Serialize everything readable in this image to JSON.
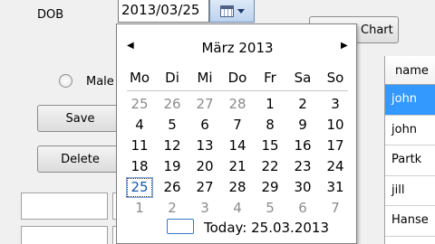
{
  "form": {
    "dob_label": "DOB",
    "dob_value": "2013/03/25",
    "chart_label": "Chart",
    "male_label": "Male",
    "save_label": "Save",
    "delete_label": "Delete"
  },
  "grid": {
    "header": "name",
    "rows": [
      "john",
      "john",
      "Partk",
      "jill",
      "Hanse"
    ],
    "selected_index": 0
  },
  "calendar": {
    "month_title": "März 2013",
    "prev_glyph": "◀",
    "next_glyph": "▶",
    "weekdays": [
      "Mo",
      "Di",
      "Mi",
      "Do",
      "Fr",
      "Sa",
      "So"
    ],
    "days": [
      {
        "d": "25",
        "other": true
      },
      {
        "d": "26",
        "other": true
      },
      {
        "d": "27",
        "other": true
      },
      {
        "d": "28",
        "other": true
      },
      {
        "d": "1"
      },
      {
        "d": "2"
      },
      {
        "d": "3"
      },
      {
        "d": "4"
      },
      {
        "d": "5"
      },
      {
        "d": "6"
      },
      {
        "d": "7"
      },
      {
        "d": "8"
      },
      {
        "d": "9"
      },
      {
        "d": "10"
      },
      {
        "d": "11"
      },
      {
        "d": "12"
      },
      {
        "d": "13"
      },
      {
        "d": "14"
      },
      {
        "d": "15"
      },
      {
        "d": "16"
      },
      {
        "d": "17"
      },
      {
        "d": "18"
      },
      {
        "d": "19"
      },
      {
        "d": "20"
      },
      {
        "d": "21"
      },
      {
        "d": "22"
      },
      {
        "d": "23"
      },
      {
        "d": "24"
      },
      {
        "d": "25",
        "today": true
      },
      {
        "d": "26"
      },
      {
        "d": "27"
      },
      {
        "d": "28"
      },
      {
        "d": "29"
      },
      {
        "d": "30"
      },
      {
        "d": "31"
      },
      {
        "d": "1",
        "other": true
      },
      {
        "d": "2",
        "other": true
      },
      {
        "d": "3",
        "other": true
      },
      {
        "d": "4",
        "other": true
      },
      {
        "d": "5",
        "other": true
      },
      {
        "d": "6",
        "other": true
      },
      {
        "d": "7",
        "other": true
      }
    ],
    "today_text": "Today: 25.03.2013"
  }
}
